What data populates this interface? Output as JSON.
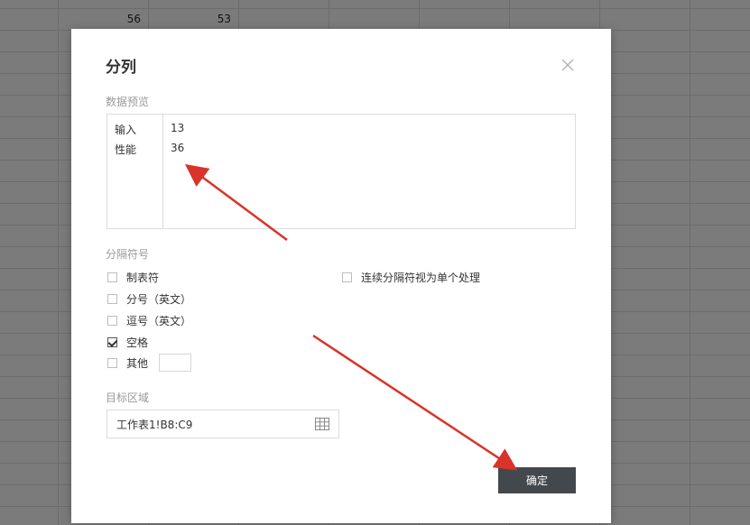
{
  "spreadsheet": {
    "visible_cells": [
      "56",
      "53"
    ]
  },
  "dialog": {
    "title": "分列",
    "data_preview": {
      "label": "数据预览",
      "rows": [
        [
          "输入",
          "13"
        ],
        [
          "性能",
          "36"
        ]
      ]
    },
    "delimiter": {
      "label": "分隔符号",
      "options": [
        {
          "label": "制表符",
          "checked": false
        },
        {
          "label": "分号（英文）",
          "checked": false
        },
        {
          "label": "逗号（英文）",
          "checked": false
        },
        {
          "label": "空格",
          "checked": true
        },
        {
          "label": "其他",
          "checked": false
        }
      ],
      "consecutive": {
        "label": "连续分隔符视为单个处理",
        "checked": false
      },
      "other_value": ""
    },
    "target": {
      "label": "目标区域",
      "value": "工作表1!B8:C9"
    },
    "ok_label": "确定"
  },
  "colors": {
    "ok_button": "#43484d",
    "annotation_arrow": "#d9332a"
  },
  "icons": {
    "close": "close-icon",
    "range_select": "grid-icon"
  }
}
